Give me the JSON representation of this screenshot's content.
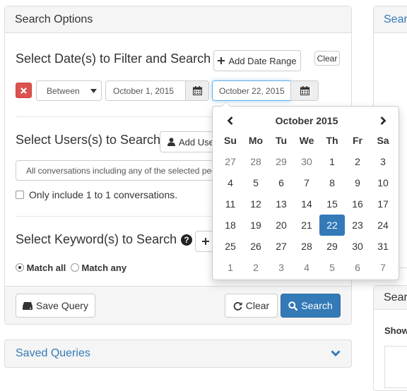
{
  "search_options": {
    "title": "Search Options",
    "dates": {
      "heading": "Select Date(s) to Filter and Search",
      "add_range_label": "Add Date Range",
      "clear_label": "Clear",
      "mode": "Between",
      "start_date": "October 1, 2015",
      "end_date": "October 22, 2015"
    },
    "users": {
      "heading": "Select Users(s) to Search",
      "add_user_label": "Add User",
      "select_placeholder": "All conversations including any of the selected people",
      "one_to_one_label": "Only include 1 to 1 conversations."
    },
    "keywords": {
      "heading": "Select Keyword(s) to Search",
      "match_all_label": "Match all",
      "match_any_label": "Match any"
    },
    "footer": {
      "save_label": "Save Query",
      "clear_label": "Clear",
      "search_label": "Search"
    }
  },
  "saved_queries": {
    "title": "Saved Queries"
  },
  "right_panel_top": {
    "title": "Sear"
  },
  "right_panel_bottom": {
    "title": "Sear",
    "show_label": "Show"
  },
  "datepicker": {
    "month_label": "October 2015",
    "weekdays": [
      "Su",
      "Mo",
      "Tu",
      "We",
      "Th",
      "Fr",
      "Sa"
    ],
    "weeks": [
      [
        "27",
        "28",
        "29",
        "30",
        "1",
        "2",
        "3"
      ],
      [
        "4",
        "5",
        "6",
        "7",
        "8",
        "9",
        "10"
      ],
      [
        "11",
        "12",
        "13",
        "14",
        "15",
        "16",
        "17"
      ],
      [
        "18",
        "19",
        "20",
        "21",
        "22",
        "23",
        "24"
      ],
      [
        "25",
        "26",
        "27",
        "28",
        "29",
        "30",
        "31"
      ],
      [
        "1",
        "2",
        "3",
        "4",
        "5",
        "6",
        "7"
      ]
    ],
    "selected_day": "22"
  },
  "colors": {
    "primary": "#337ab7",
    "danger": "#d9534f",
    "link": "#337ab7"
  }
}
